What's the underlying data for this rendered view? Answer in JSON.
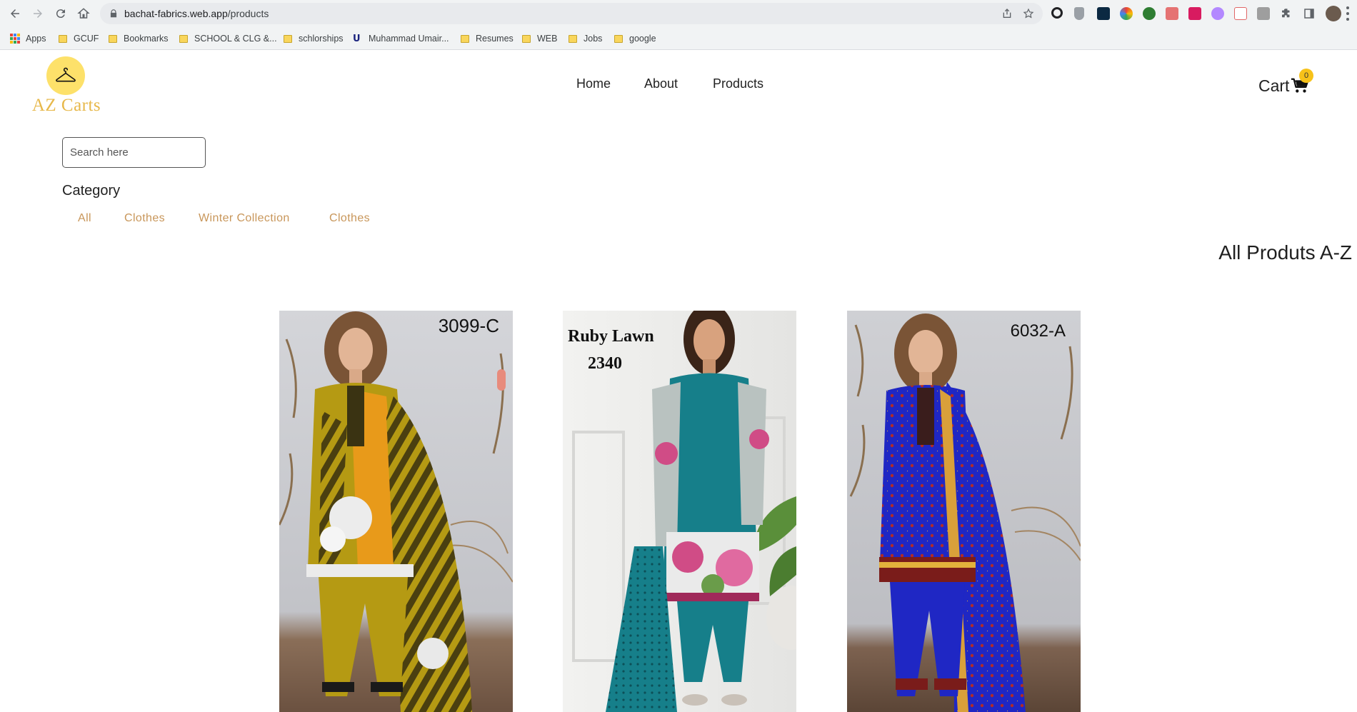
{
  "browser": {
    "url_host": "bachat-fabrics.web.app",
    "url_path": "/products",
    "bookmarks": [
      {
        "label": "Apps",
        "kind": "apps"
      },
      {
        "label": "GCUF",
        "kind": "folder"
      },
      {
        "label": "Bookmarks",
        "kind": "folder"
      },
      {
        "label": "SCHOOL & CLG &...",
        "kind": "folder"
      },
      {
        "label": "schlorships",
        "kind": "folder"
      },
      {
        "label": "Muhammad Umair...",
        "kind": "site"
      },
      {
        "label": "Resumes",
        "kind": "folder"
      },
      {
        "label": "WEB",
        "kind": "folder"
      },
      {
        "label": "Jobs",
        "kind": "folder"
      },
      {
        "label": "google",
        "kind": "folder"
      }
    ]
  },
  "site": {
    "logo_text": "AZ Carts",
    "logo_icon": "hanger-icon",
    "nav": [
      "Home",
      "About",
      "Products"
    ],
    "cart_label": "Cart",
    "cart_count": "0"
  },
  "filters": {
    "search_placeholder": "Search here",
    "category_title": "Category",
    "categories": [
      "All",
      "Clothes",
      "Winter Collection",
      "Clothes"
    ]
  },
  "products_section": {
    "title": "All Produts A-Z",
    "products": [
      {
        "code": "3099-C",
        "colors": {
          "main": "#b59a13",
          "accent": "#e89a1a",
          "bg": "#c9cace"
        }
      },
      {
        "code_line1": "Ruby Lawn",
        "code_line2": "2340",
        "colors": {
          "main": "#167f8a",
          "accent": "#d04c86",
          "bg": "#ececea"
        }
      },
      {
        "code": "6032-A",
        "colors": {
          "main": "#1f27c4",
          "accent": "#b32a26",
          "bg": "#bfc0c4"
        }
      }
    ]
  },
  "colors": {
    "accent_gold": "#e7b84a",
    "category_link": "#c8965a",
    "badge": "#f7c21a"
  }
}
